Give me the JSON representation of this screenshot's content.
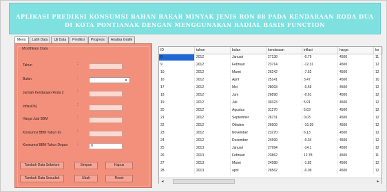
{
  "banner": {
    "line1": "APLIKASI PREDIKSI KONSUMSI BAHAN BAKAR MINYAK JENIS RON 88 PADA KENDARAAN RODA DUA",
    "line2": "DI KOTA PONTIANAK DENGAN MENGGUNAKAN RADIAL BASIS FUNCTION"
  },
  "tabs": [
    "Menu",
    "Latih Data",
    "Uji Data",
    "Prediksi",
    "Progress",
    "Analisa Grafik"
  ],
  "form": {
    "group_title": "Modifikasi Data",
    "labels": {
      "tahun": "Tahun",
      "bulan": "Bulan",
      "jumlah": "Jumlah Kendaraan Roda 2",
      "inflasi": "Inflasi(%)",
      "harga": "Harga Jual BBM",
      "konsumsi_ini": "Konsumsi BBM Tahun Ini",
      "konsumsi_depan": "Konsumsi BBM Tahun Depan"
    },
    "colon": ":",
    "values": {
      "tahun": "",
      "jumlah": "",
      "inflasi": "",
      "harga": "",
      "konsumsi_ini": "",
      "konsumsi_depan": "0"
    },
    "buttons": {
      "sebelum": "Tambah Data Sebelum",
      "simpan": "Simpan",
      "hapus": "Hapus",
      "sesudah": "Tambah Data Sesudah",
      "ubah": "Ubah",
      "reset": "Reset"
    },
    "select_arrow": "▾"
  },
  "grid": {
    "columns": [
      "ID",
      "tahun",
      "bulan",
      "kendaraan",
      "inflasi",
      "harga",
      "ko"
    ],
    "rows": [
      [
        "8",
        "2012",
        "Januari",
        "27138",
        "-0.79",
        "4500",
        "11"
      ],
      [
        "9",
        "2012",
        "Februari",
        "23714",
        "-12.31",
        "4500",
        "12"
      ],
      [
        "10",
        "2012",
        "Maret",
        "26242",
        "-7.62",
        "4500",
        "12"
      ],
      [
        "16",
        "2012",
        "April",
        "25141",
        "3.47",
        "4500",
        "10"
      ],
      [
        "17",
        "2012",
        "Mei",
        "28093",
        "-0.59",
        "4500",
        "12"
      ],
      [
        "18",
        "2012",
        "Juni",
        "26898",
        "-0.61",
        "4500",
        "12"
      ],
      [
        "19",
        "2012",
        "Juli",
        "30323",
        "5.91",
        "4500",
        "12"
      ],
      [
        "20",
        "2012",
        "Agustus",
        "31270",
        "5.63",
        "4500",
        "12"
      ],
      [
        "21",
        "2012",
        "September",
        "26731",
        "0.03",
        "4500",
        "12"
      ],
      [
        "22",
        "2012",
        "Oktober",
        "26909",
        "-10.39",
        "4500",
        "12"
      ],
      [
        "23",
        "2012",
        "November",
        "23270",
        "6.13",
        "4500",
        "12"
      ],
      [
        "24",
        "2012",
        "Desember",
        "24599",
        "-0.34",
        "4500",
        "12"
      ],
      [
        "25",
        "2013",
        "Januari",
        "27994",
        "-14.1",
        "4500",
        "12"
      ],
      [
        "26",
        "2013",
        "Februari",
        "23862",
        "12.78",
        "4500",
        "11"
      ],
      [
        "27",
        "2013",
        "Maret",
        "24588",
        "-1.82",
        "4500",
        "12"
      ],
      [
        "28",
        "2013",
        "april",
        "26562",
        "-0.09",
        "4500",
        "12"
      ]
    ],
    "scroll_left": "◂",
    "scroll_right": "▸"
  }
}
